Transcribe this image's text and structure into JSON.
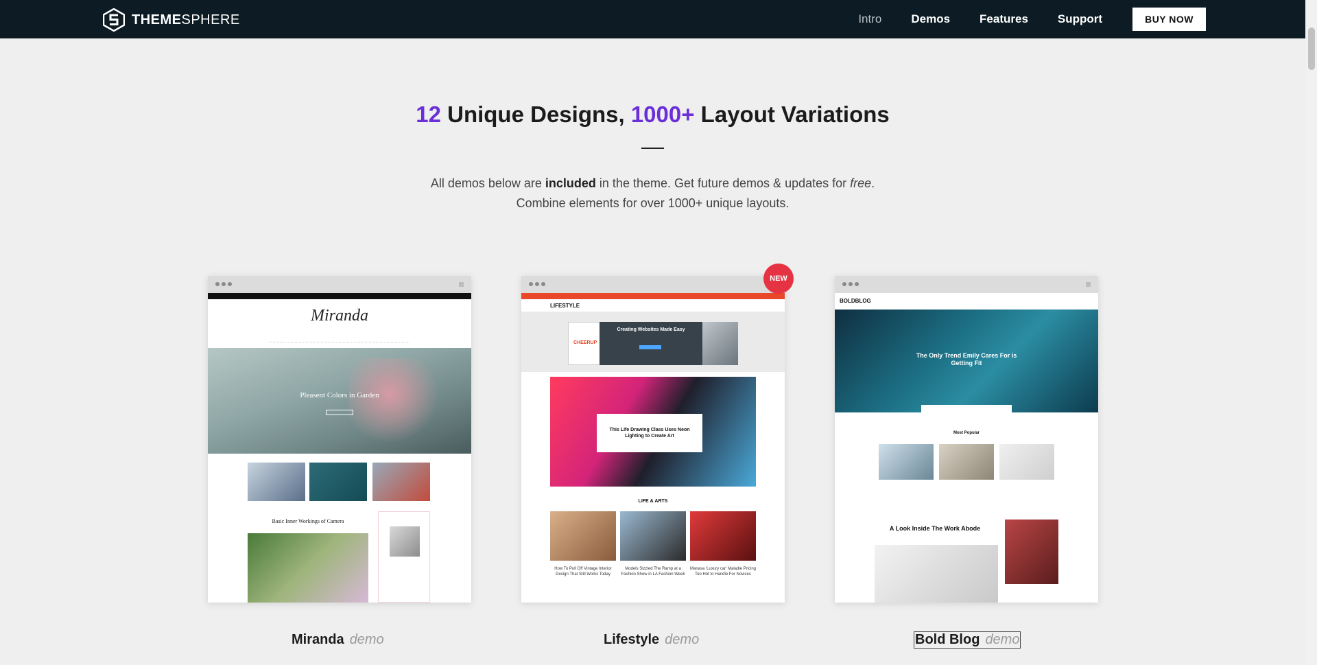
{
  "brand": {
    "name_bold": "THEME",
    "name_rest": "SPHERE"
  },
  "nav": {
    "items": [
      {
        "label": "Intro",
        "muted": true
      },
      {
        "label": "Demos"
      },
      {
        "label": "Features"
      },
      {
        "label": "Support"
      }
    ],
    "cta": "BUY NOW"
  },
  "hero": {
    "num1": "12",
    "text1": " Unique Designs, ",
    "num2": "1000+",
    "text2": " Layout Variations",
    "line1_a": "All demos below are ",
    "line1_b": "included",
    "line1_c": " in the theme. Get future demos & updates for ",
    "line1_d": "free",
    "line1_e": ".",
    "line2": "Combine elements for over 1000+ unique layouts."
  },
  "demos": [
    {
      "name": "Miranda",
      "suffix": "demo",
      "logo": "Miranda",
      "hero_title": "Pleasent Colors in Garden",
      "post_title": "Basic Inner Workings of Camera"
    },
    {
      "name": "Lifestyle",
      "suffix": "demo",
      "badge": "NEW",
      "logo": "LIFESTYLE",
      "ad_title": "Creating Websites Made Easy",
      "ad_brand": "CHEERUP",
      "feature_title": "This Life Drawing Class Uses Neon Lighting to Create Art",
      "section": "LIFE & ARTS",
      "posts": [
        "How To Pull Off Vintage Interior Design That Still Works Today",
        "Models Sizzled The Ramp at a Fashion Show in LA Fashion Week",
        "Manasa 'Luxury car' Maladie Pricing Too Hot to Handle For Novices"
      ]
    },
    {
      "name": "Bold Blog",
      "suffix": "demo",
      "logo": "BOLDBLOG",
      "hero_title": "The Only Trend Emily Cares For is Getting Fit",
      "section": "Most Popular",
      "feature_title": "A Look Inside The Work Abode"
    }
  ],
  "colors": {
    "accent": "#6a2fd9",
    "topbar": "#0d1c24",
    "badge": "#e63344",
    "lifestyle_bar": "#e9462a"
  }
}
